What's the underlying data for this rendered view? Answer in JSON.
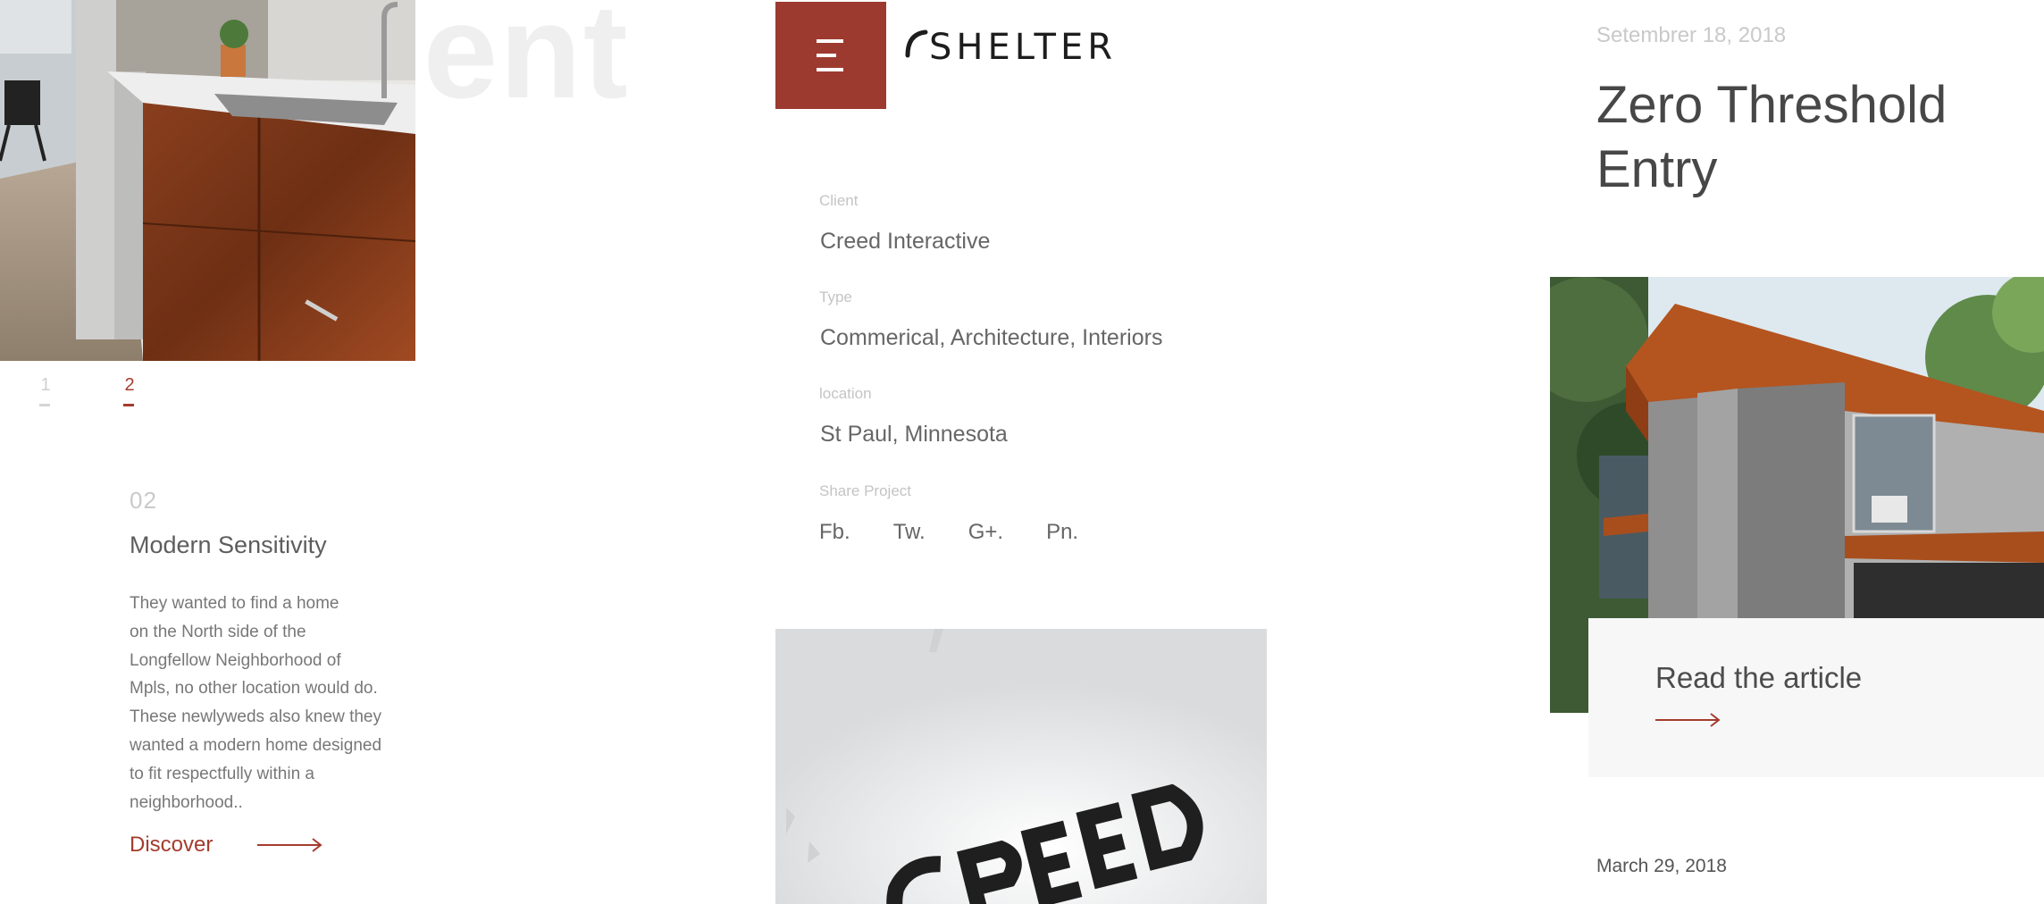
{
  "watermark": "Client",
  "slider": {
    "pages": [
      "1",
      "2"
    ],
    "active_index": 1,
    "number": "02",
    "title": "Modern Sensitivity",
    "body_lines": [
      "They wanted to find a home",
      "on the North side of the",
      "Longfellow Neighborhood of",
      "Mpls, no other location would do.",
      "These newlyweds also knew they",
      "wanted a modern home designed",
      "to fit respectfully within a",
      "neighborhood.."
    ],
    "cta_label": "Discover"
  },
  "header": {
    "menu_icon": "hamburger-menu-icon",
    "logo_text": "SHELTER"
  },
  "project": {
    "client_label": "Client",
    "client_value": "Creed Interactive",
    "type_label": "Type",
    "type_value": "Commerical, Architecture, Interiors",
    "location_label": "location",
    "location_value": "St Paul, Minnesota",
    "share_label": "Share Project",
    "share_links": [
      "Fb.",
      "Tw.",
      "G+.",
      "Pn."
    ]
  },
  "article": {
    "date": "Setembrer 18, 2018",
    "title": "Zero Threshold Entry",
    "cta_label": "Read the article"
  },
  "next_article": {
    "date": "March 29, 2018"
  },
  "colors": {
    "accent": "#a33c2e",
    "menu_bg": "#9d3a2f"
  }
}
